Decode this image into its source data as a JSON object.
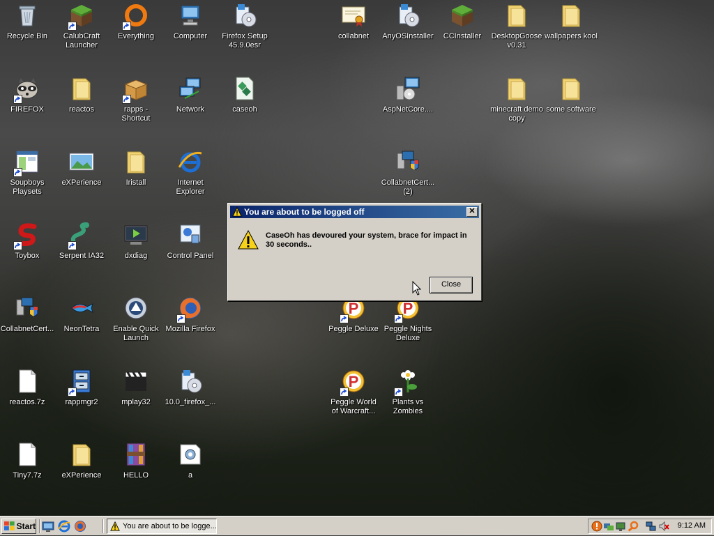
{
  "desktop": {
    "icons": [
      {
        "label": "Recycle Bin",
        "icon": "recycle-bin-icon",
        "shortcut": false
      },
      {
        "label": "CalubCraft\nLauncher",
        "icon": "minecraft-block-icon",
        "shortcut": true
      },
      {
        "label": "Everything",
        "icon": "everything-search-icon",
        "shortcut": true
      },
      {
        "label": "Computer",
        "icon": "computer-icon",
        "shortcut": false
      },
      {
        "label": "Firefox Setup\n45.9.0esr",
        "icon": "installer-icon",
        "shortcut": false
      },
      {
        "label": "collabnet",
        "icon": "certificate-icon",
        "shortcut": false
      },
      {
        "label": "AnyOSInstaller",
        "icon": "installer-icon",
        "shortcut": false
      },
      {
        "label": "CCInstaller",
        "icon": "minecraft-block-icon",
        "shortcut": false
      },
      {
        "label": "DesktopGoose\nv0.31",
        "icon": "folder-icon",
        "shortcut": false
      },
      {
        "label": "wallpapers kool",
        "icon": "folder-icon",
        "shortcut": false
      },
      {
        "label": "FIREFOX",
        "icon": "raccoon-icon",
        "shortcut": true
      },
      {
        "label": "reactos",
        "icon": "folder-icon",
        "shortcut": false
      },
      {
        "label": "rapps -\nShortcut",
        "icon": "package-box-icon",
        "shortcut": true
      },
      {
        "label": "Network",
        "icon": "network-icon",
        "shortcut": false
      },
      {
        "label": "caseoh",
        "icon": "script-file-icon",
        "shortcut": false
      },
      {
        "label": "AspNetCore....",
        "icon": "setup-computer-icon",
        "shortcut": false
      },
      {
        "label": "minecraft demo\ncopy",
        "icon": "folder-icon",
        "shortcut": false
      },
      {
        "label": "some software",
        "icon": "folder-icon",
        "shortcut": false
      },
      {
        "label": "Soupboys\nPlaysets",
        "icon": "window-app-icon",
        "shortcut": true
      },
      {
        "label": "eXPerience",
        "icon": "landscape-image-icon",
        "shortcut": false
      },
      {
        "label": "Iristall",
        "icon": "folder-icon",
        "shortcut": false
      },
      {
        "label": "Internet\nExplorer",
        "icon": "internet-explorer-icon",
        "shortcut": false
      },
      {
        "label": "CollabnetCert...\n(2)",
        "icon": "shield-computer-icon",
        "shortcut": false
      },
      {
        "label": "Toybox",
        "icon": "toybox-s-icon",
        "shortcut": true
      },
      {
        "label": "Serpent IA32",
        "icon": "serpent-icon",
        "shortcut": true
      },
      {
        "label": "dxdiag",
        "icon": "dxdiag-icon",
        "shortcut": false
      },
      {
        "label": "Control Panel",
        "icon": "control-panel-icon",
        "shortcut": false
      },
      {
        "label": "CollabnetCert...",
        "icon": "shield-computer-icon",
        "shortcut": false
      },
      {
        "label": "NeonTetra",
        "icon": "fish-icon",
        "shortcut": false
      },
      {
        "label": "Enable Quick\nLaunch",
        "icon": "quick-launch-icon",
        "shortcut": false
      },
      {
        "label": "Mozilla Firefox",
        "icon": "firefox-icon",
        "shortcut": true
      },
      {
        "label": "Peggle Deluxe",
        "icon": "peggle-icon",
        "shortcut": true
      },
      {
        "label": "Peggle Nights\nDeluxe",
        "icon": "peggle-icon",
        "shortcut": true
      },
      {
        "label": "reactos.7z",
        "icon": "blank-file-icon",
        "shortcut": false
      },
      {
        "label": "rappmgr2",
        "icon": "file-cabinet-icon",
        "shortcut": true
      },
      {
        "label": "mplay32",
        "icon": "clapperboard-icon",
        "shortcut": false
      },
      {
        "label": "10.0_firefox_...",
        "icon": "installer-icon",
        "shortcut": false
      },
      {
        "label": "Peggle World\nof Warcraft...",
        "icon": "peggle-icon",
        "shortcut": true
      },
      {
        "label": "Plants vs\nZombies",
        "icon": "flower-icon",
        "shortcut": true
      },
      {
        "label": "Tiny7.7z",
        "icon": "blank-file-icon",
        "shortcut": false
      },
      {
        "label": "eXPerience",
        "icon": "folder-icon",
        "shortcut": false
      },
      {
        "label": "HELLO",
        "icon": "winrar-icon",
        "shortcut": false
      },
      {
        "label": "a",
        "icon": "settings-file-icon",
        "shortcut": false
      }
    ]
  },
  "dialog": {
    "title": "You are about to be logged off",
    "message": "CaseOh has devoured your system, brace for impact in 30 seconds..",
    "close_button": "Close",
    "title_close": "✕"
  },
  "taskbar": {
    "start_label": "Start",
    "task_label": "You are about to be logge...",
    "clock": "9:12 AM"
  }
}
